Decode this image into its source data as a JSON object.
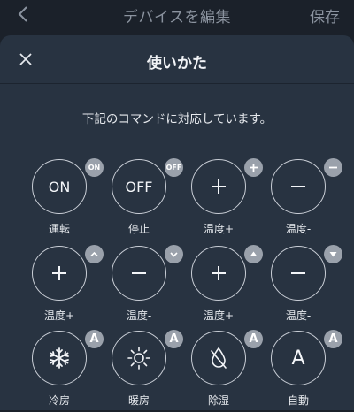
{
  "topbar": {
    "title": "デバイスを編集",
    "save_label": "保存"
  },
  "sheet": {
    "title": "使いかた",
    "description": "下記のコマンドに対応しています。"
  },
  "commands": [
    {
      "main": "ON",
      "badge": "ON",
      "label": "運転"
    },
    {
      "main": "OFF",
      "badge": "OFF",
      "label": "停止"
    },
    {
      "main": "+",
      "badge": "+",
      "label": "温度+"
    },
    {
      "main": "−",
      "badge": "−",
      "label": "温度-"
    },
    {
      "main": "+",
      "badge": "^",
      "label": "温度+"
    },
    {
      "main": "−",
      "badge": "v",
      "label": "温度-"
    },
    {
      "main": "+",
      "badge": "▲",
      "label": "温度+"
    },
    {
      "main": "−",
      "badge": "▼",
      "label": "温度-"
    },
    {
      "main": "snowflake-icon",
      "badge": "A",
      "label": "冷房"
    },
    {
      "main": "sun-icon",
      "badge": "A",
      "label": "暖房"
    },
    {
      "main": "droplet-slash-icon",
      "badge": "A",
      "label": "除湿"
    },
    {
      "main": "A",
      "badge": "A",
      "label": "自動"
    }
  ]
}
